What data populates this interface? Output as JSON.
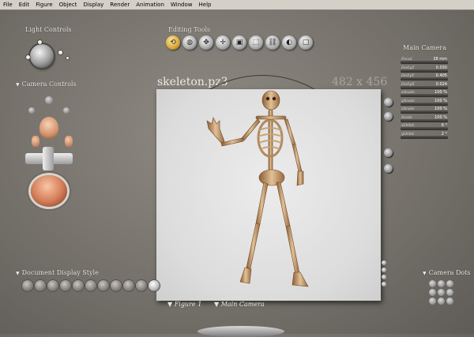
{
  "menu": [
    "File",
    "Edit",
    "Figure",
    "Object",
    "Display",
    "Render",
    "Animation",
    "Window",
    "Help"
  ],
  "light_controls": {
    "label": "Light Controls"
  },
  "camera_controls": {
    "label": "Camera Controls"
  },
  "editing_tools": {
    "label": "Editing Tools",
    "tools": [
      {
        "name": "rotate-tool",
        "glyph": "⟲",
        "active": true
      },
      {
        "name": "twist-tool",
        "glyph": "◍"
      },
      {
        "name": "translate-tool",
        "glyph": "✥"
      },
      {
        "name": "translate-in-out-tool",
        "glyph": "✛"
      },
      {
        "name": "scale-tool",
        "glyph": "▣"
      },
      {
        "name": "taper-tool",
        "glyph": "⬚"
      },
      {
        "name": "chain-break-tool",
        "glyph": "⛓"
      },
      {
        "name": "color-tool",
        "glyph": "◐"
      },
      {
        "name": "view-magnifier-tool",
        "glyph": "▢"
      }
    ]
  },
  "document": {
    "title": "skeleton.pz3",
    "size": "482 x 456"
  },
  "main_camera": {
    "label": "Main Camera",
    "params": [
      {
        "label": "Focal",
        "value": "38 mm"
      },
      {
        "label": "DollyZ",
        "value": "0.030"
      },
      {
        "label": "DollyY",
        "value": "0.405"
      },
      {
        "label": "DollyX",
        "value": "0.024"
      },
      {
        "label": "xScale",
        "value": "100 %"
      },
      {
        "label": "yScale",
        "value": "100 %"
      },
      {
        "label": "zScale",
        "value": "100 %"
      },
      {
        "label": "Scale",
        "value": "100 %"
      },
      {
        "label": "xOrbit",
        "value": "6 °"
      },
      {
        "label": "yOrbit",
        "value": "2 °"
      }
    ]
  },
  "document_display_style": {
    "label": "Document Display Style",
    "count": 11
  },
  "camera_dots": {
    "label": "Camera Dots",
    "count": 9
  },
  "figure_menu": "Figure 1",
  "camera_menu": "Main Camera",
  "colors": {
    "bone": "#c8a070",
    "bone_dark": "#7a5230",
    "accent": "#d7a53a"
  }
}
